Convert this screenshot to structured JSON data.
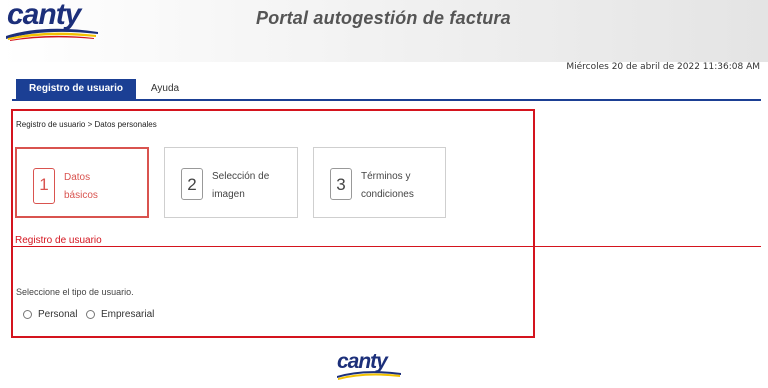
{
  "header": {
    "logo_text": "canty",
    "title": "Portal autogestión de factura"
  },
  "date_text": "Miércoles 20 de abril de 2022 11:36:08 AM",
  "tabs": [
    {
      "label": "Registro de usuario",
      "active": true
    },
    {
      "label": "Ayuda",
      "active": false
    }
  ],
  "breadcrumb": "Registro de usuario > Datos personales",
  "steps": [
    {
      "number": "1",
      "line1": "Datos",
      "line2": "básicos",
      "active": true
    },
    {
      "number": "2",
      "line1": "Selección de",
      "line2": "imagen",
      "active": false
    },
    {
      "number": "3",
      "line1": "Términos y",
      "line2": "condiciones",
      "active": false
    }
  ],
  "section_title": "Registro de usuario",
  "user_type": {
    "prompt": "Seleccione el tipo de usuario.",
    "options": [
      "Personal",
      "Empresarial"
    ]
  },
  "footer": {
    "logo_text": "canty"
  },
  "colors": {
    "primary": "#1b3f94",
    "accent_red": "#d4141e",
    "logo_blue": "#1c2f7a",
    "logo_yellow": "#f2c200"
  },
  "icons": [
    "radio-unselected-icon"
  ]
}
